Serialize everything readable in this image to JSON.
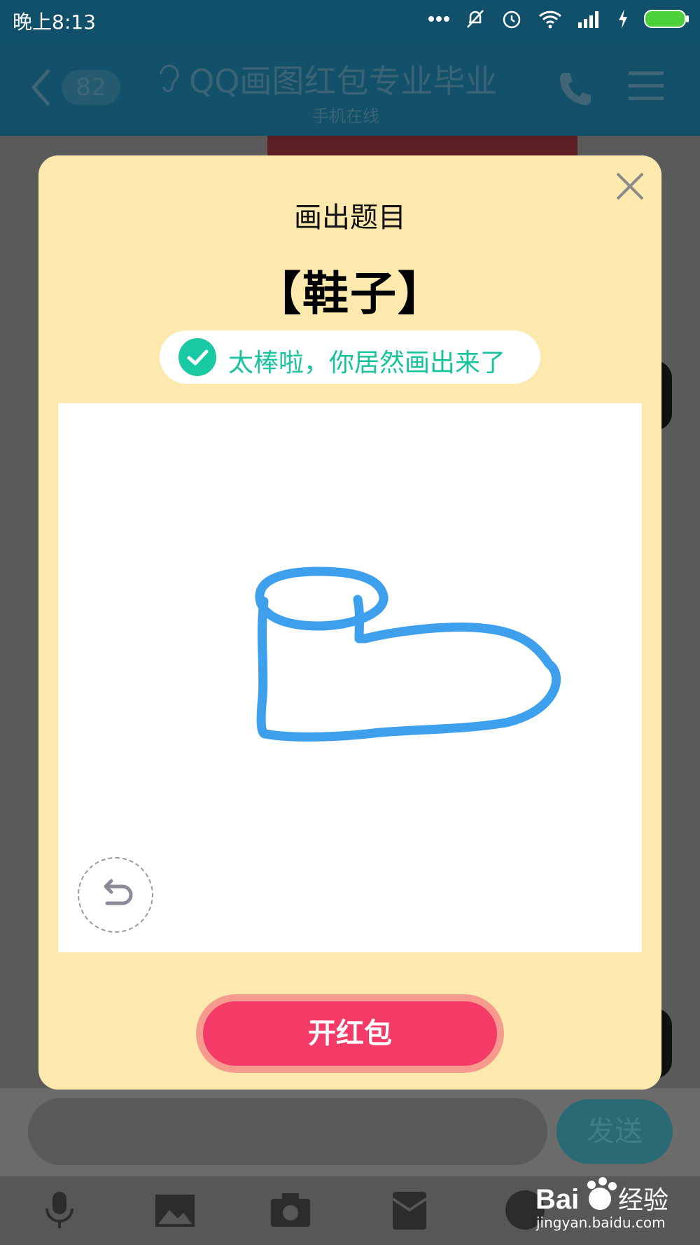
{
  "status_bar": {
    "time": "晚上8:13"
  },
  "title_bar": {
    "unread_count": "82",
    "chat_title": "QQ画图红包专业毕业",
    "subtitle": "手机在线"
  },
  "dialog": {
    "title": "画出题目",
    "word": "【鞋子】",
    "success_message": "太棒啦，你居然画出来了",
    "open_button": "开红包"
  },
  "bottom": {
    "send_label": "发送"
  },
  "watermark": {
    "logo": "Baidu经验",
    "url": "jingyan.baidu.com"
  },
  "colors": {
    "accent": "#f43a66",
    "success": "#16c39d",
    "stroke": "#3ea0ec",
    "dialog_bg": "#fde8ae"
  }
}
